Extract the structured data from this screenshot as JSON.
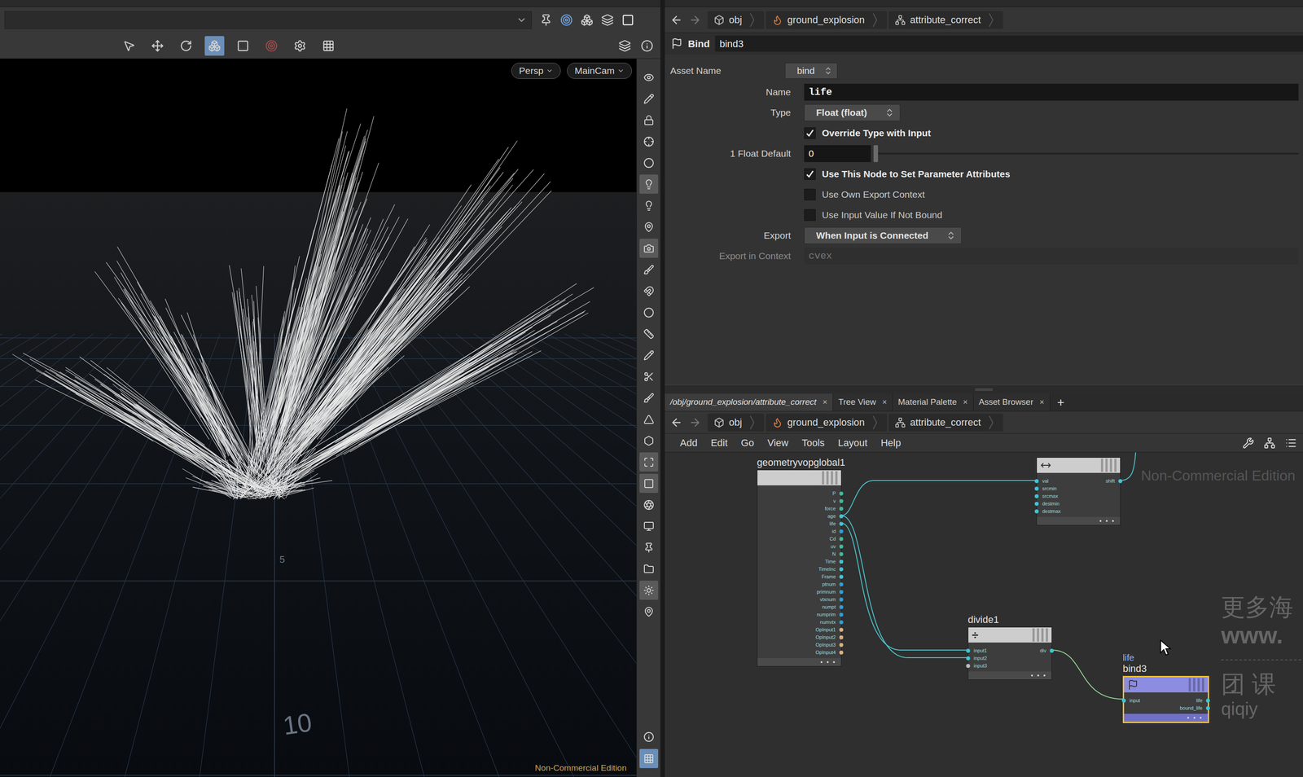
{
  "viewport": {
    "camera_buttons": [
      "Persp",
      "MainCam"
    ],
    "grid_labels": [
      "5",
      "10"
    ],
    "edition": "Non-Commercial Edition"
  },
  "viewport_toolbar": [
    {
      "selected": false
    },
    {
      "selected": false
    },
    {
      "selected": false
    },
    {
      "selected": true
    },
    {
      "selected": false
    },
    {
      "selected": false
    },
    {
      "selected": false
    },
    {
      "selected": false
    },
    {
      "selected": false
    },
    {
      "selected": false
    }
  ],
  "side_tools": [
    {
      "selected": false
    },
    {
      "selected": false
    },
    {
      "selected": false
    },
    {
      "selected": false
    },
    {
      "selected": false
    },
    {
      "selected": true
    },
    {
      "selected": false
    },
    {
      "selected": false
    },
    {
      "selected": true
    },
    {
      "selected": false
    },
    {
      "selected": false
    },
    {
      "selected": false
    },
    {
      "selected": false
    },
    {
      "selected": false
    },
    {
      "selected": false
    },
    {
      "selected": false
    },
    {
      "selected": false
    },
    {
      "selected": false
    },
    {
      "selected": true
    },
    {
      "selected": true
    },
    {
      "selected": false
    },
    {
      "selected": false
    },
    {
      "selected": false
    },
    {
      "selected": false
    },
    {
      "selected": true
    },
    {
      "selected": false
    },
    {
      "selected": false
    },
    {
      "selected": true
    }
  ],
  "parameter_path": [
    "obj",
    "ground_explosion",
    "attribute_correct"
  ],
  "node_header": {
    "type": "Bind",
    "name": "bind3"
  },
  "asset_name": {
    "label": "Asset Name",
    "value": "bind"
  },
  "parameters": [
    {
      "kind": "text",
      "label": "Name",
      "value": "life",
      "disabled": false
    },
    {
      "kind": "dropdown",
      "label": "Type",
      "value": "Float (float)",
      "disabled": false
    },
    {
      "kind": "checkbox",
      "label": "Override Type with Input",
      "checked": true,
      "disabled": false
    },
    {
      "kind": "slider",
      "label": "1 Float Default",
      "value": "0",
      "level": 0,
      "disabled": false
    },
    {
      "kind": "checkbox",
      "label": "Use This Node to Set Parameter Attributes",
      "checked": true,
      "disabled": false
    },
    {
      "kind": "checkbox",
      "label": "Use Own Export Context",
      "checked": false,
      "disabled": false
    },
    {
      "kind": "checkbox",
      "label": "Use Input Value If Not Bound",
      "checked": false,
      "disabled": false
    },
    {
      "kind": "dropdown",
      "label": "Export",
      "value": "When Input is Connected",
      "disabled": false
    },
    {
      "kind": "text",
      "label": "Export in Context",
      "value": "cvex",
      "disabled": true
    }
  ],
  "pane_tabs": [
    {
      "label": "/obj/ground_explosion/attribute_correct",
      "selected": true,
      "close": "×"
    },
    {
      "label": "Tree View",
      "selected": false,
      "close": "×"
    },
    {
      "label": "Material Palette",
      "selected": false,
      "close": "×"
    },
    {
      "label": "Asset Browser",
      "selected": false,
      "close": "×"
    }
  ],
  "add_tab": "+",
  "network_path": [
    "obj",
    "ground_explosion",
    "attribute_correct"
  ],
  "network_menu": [
    "Add",
    "Edit",
    "Go",
    "View",
    "Tools",
    "Layout",
    "Help"
  ],
  "network": {
    "watermark": "Non-Commercial Edition",
    "nodes": [
      {
        "name": "geometryvopglobal1",
        "color": "#cdcdcd",
        "selected": false,
        "inputs": [],
        "outputs": [
          {
            "label": "P",
            "color": "#3fb89a"
          },
          {
            "label": "v",
            "color": "#3fb89a"
          },
          {
            "label": "force",
            "color": "#3fb89a"
          },
          {
            "label": "age",
            "color": "#3ec4d2"
          },
          {
            "label": "life",
            "color": "#3ec4d2"
          },
          {
            "label": "id",
            "color": "#2d9ed8"
          },
          {
            "label": "Cd",
            "color": "#3fb89a"
          },
          {
            "label": "uv",
            "color": "#3fb89a"
          },
          {
            "label": "N",
            "color": "#3fb89a"
          },
          {
            "label": "Time",
            "color": "#3ec4d2"
          },
          {
            "label": "TimeInc",
            "color": "#3ec4d2"
          },
          {
            "label": "Frame",
            "color": "#3ec4d2"
          },
          {
            "label": "ptnum",
            "color": "#2d9ed8"
          },
          {
            "label": "primnum",
            "color": "#2d9ed8"
          },
          {
            "label": "vtxnum",
            "color": "#2d9ed8"
          },
          {
            "label": "numpt",
            "color": "#2d9ed8"
          },
          {
            "label": "numprim",
            "color": "#2d9ed8"
          },
          {
            "label": "numvtx",
            "color": "#2d9ed8"
          },
          {
            "label": "OpInput1",
            "color": "#d8b080"
          },
          {
            "label": "OpInput2",
            "color": "#d8b080"
          },
          {
            "label": "OpInput3",
            "color": "#d8b080"
          },
          {
            "label": "OpInput4",
            "color": "#d8b080"
          }
        ]
      },
      {
        "color": "#cdcdcd",
        "selected": false,
        "inputs": [
          {
            "label": "val",
            "color": "#3ec4d2"
          },
          {
            "label": "srcmin",
            "color": "#3ec4d2"
          },
          {
            "label": "srcmax",
            "color": "#3ec4d2"
          },
          {
            "label": "destmin",
            "color": "#3ec4d2"
          },
          {
            "label": "destmax",
            "color": "#3ec4d2"
          }
        ],
        "outputs": [
          {
            "label": "shift",
            "color": "#3ec4d2"
          }
        ]
      },
      {
        "name": "divide1",
        "glyph": "÷",
        "color": "#cdcdcd",
        "selected": false,
        "inputs": [
          {
            "label": "input1",
            "color": "#3ec4d2"
          },
          {
            "label": "input2",
            "color": "#3ec4d2"
          },
          {
            "label": "input3",
            "color": "#bbbbbb"
          }
        ],
        "outputs": [
          {
            "label": "div",
            "color": "#3ec4d2"
          }
        ]
      },
      {
        "name": "bind3",
        "tag": "life",
        "color": "#8c8ce0",
        "selected": true,
        "inputs": [
          {
            "label": "input",
            "color": "#3ec4d2"
          }
        ],
        "outputs": [
          {
            "label": "life",
            "color": "#3ec4d2"
          },
          {
            "label": "bound_life",
            "color": "#3ec4d2"
          }
        ]
      }
    ]
  },
  "overlay_watermark": [
    "更多海",
    "www.",
    "团 课",
    "qiqiy"
  ]
}
